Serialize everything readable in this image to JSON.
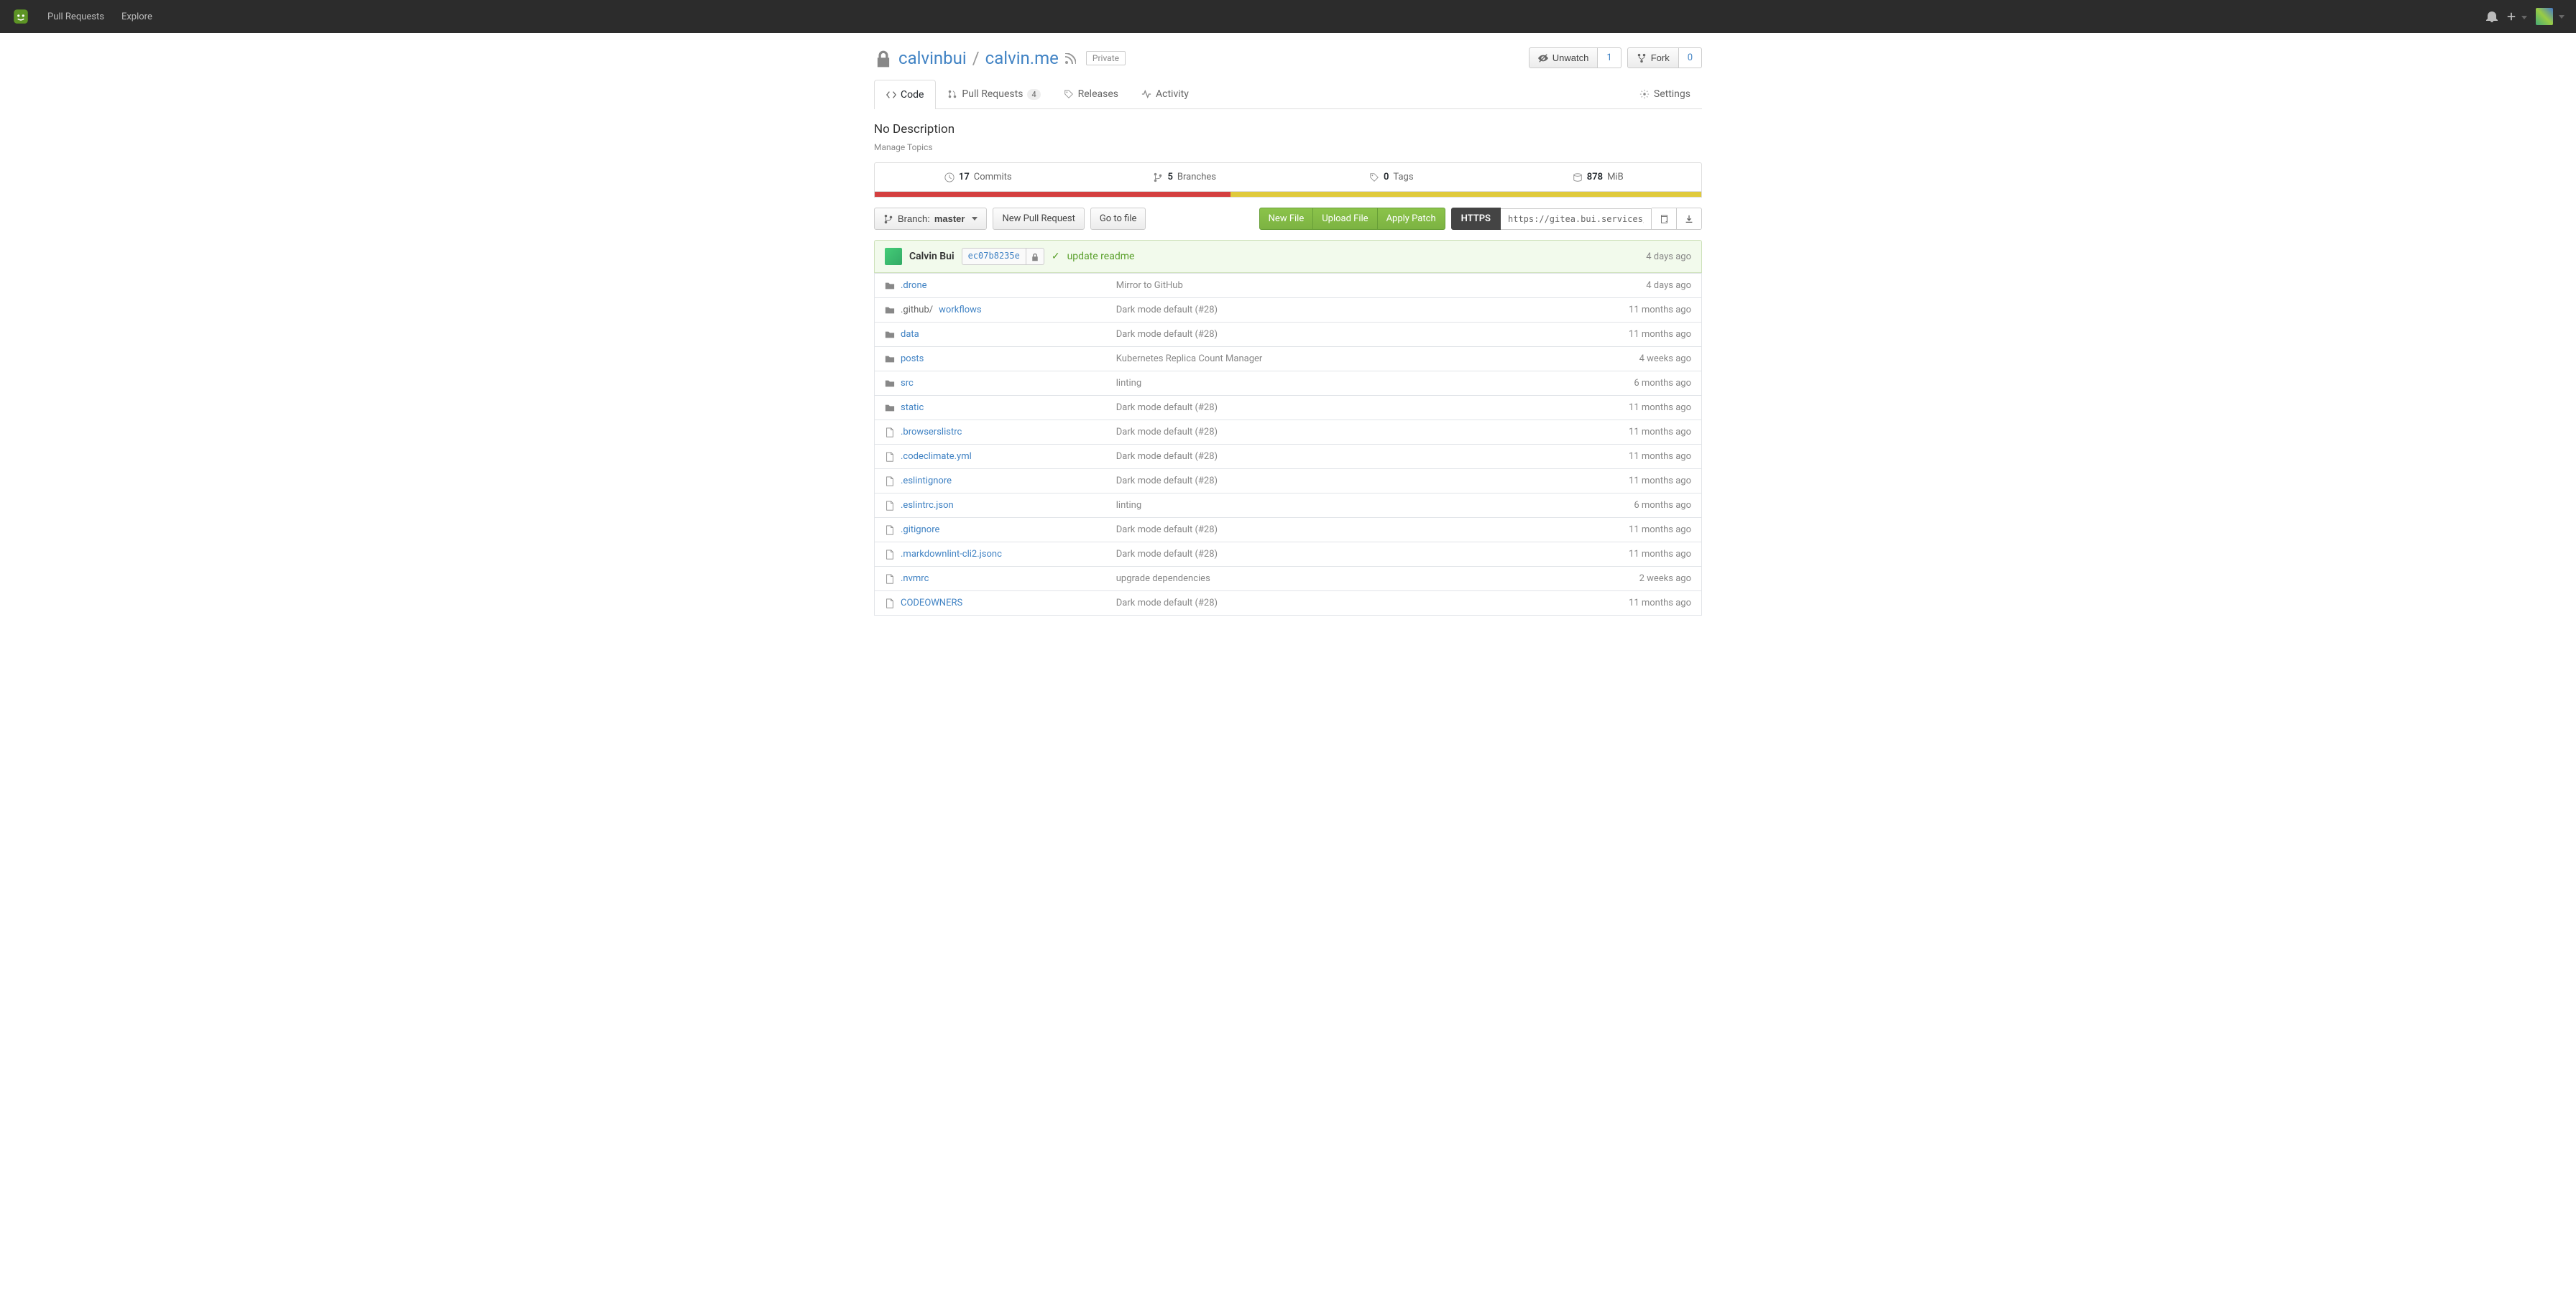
{
  "nav": {
    "pull_requests": "Pull Requests",
    "explore": "Explore"
  },
  "repo": {
    "owner": "calvinbui",
    "name": "calvin.me",
    "divider": "/",
    "visibility_badge": "Private",
    "unwatch_label": "Unwatch",
    "watch_count": "1",
    "fork_label": "Fork",
    "fork_count": "0"
  },
  "tabs": {
    "code": "Code",
    "pull_requests": "Pull Requests",
    "pull_requests_count": "4",
    "releases": "Releases",
    "activity": "Activity",
    "settings": "Settings"
  },
  "description": "No Description",
  "manage_topics": "Manage Topics",
  "stats": {
    "commits_count": "17",
    "commits_label": "Commits",
    "branches_count": "5",
    "branches_label": "Branches",
    "tags_count": "0",
    "tags_label": "Tags",
    "size_value": "878",
    "size_unit": "MiB"
  },
  "toolbar": {
    "branch_prefix": "Branch:",
    "branch_value": "master",
    "new_pr": "New Pull Request",
    "go_to_file": "Go to file",
    "new_file": "New File",
    "upload_file": "Upload File",
    "apply_patch": "Apply Patch",
    "https_label": "HTTPS",
    "clone_url": "https://gitea.bui.services/calvinbui/c"
  },
  "commit_bar": {
    "author": "Calvin Bui",
    "hash": "ec07b8235e",
    "message": "update readme",
    "time": "4 days ago"
  },
  "files": [
    {
      "icon": "dir",
      "name": ".drone",
      "name_plain": "",
      "msg": "Mirror to GitHub",
      "time": "4 days ago"
    },
    {
      "icon": "dir",
      "name": "workflows",
      "name_plain": ".github/",
      "msg": "Dark mode default (#28)",
      "time": "11 months ago"
    },
    {
      "icon": "dir",
      "name": "data",
      "name_plain": "",
      "msg": "Dark mode default (#28)",
      "time": "11 months ago"
    },
    {
      "icon": "dir",
      "name": "posts",
      "name_plain": "",
      "msg": "Kubernetes Replica Count Manager",
      "time": "4 weeks ago"
    },
    {
      "icon": "dir",
      "name": "src",
      "name_plain": "",
      "msg": "linting",
      "time": "6 months ago"
    },
    {
      "icon": "dir",
      "name": "static",
      "name_plain": "",
      "msg": "Dark mode default (#28)",
      "time": "11 months ago"
    },
    {
      "icon": "file",
      "name": ".browserslistrc",
      "name_plain": "",
      "msg": "Dark mode default (#28)",
      "time": "11 months ago"
    },
    {
      "icon": "file",
      "name": ".codeclimate.yml",
      "name_plain": "",
      "msg": "Dark mode default (#28)",
      "time": "11 months ago"
    },
    {
      "icon": "file",
      "name": ".eslintignore",
      "name_plain": "",
      "msg": "Dark mode default (#28)",
      "time": "11 months ago"
    },
    {
      "icon": "file",
      "name": ".eslintrc.json",
      "name_plain": "",
      "msg": "linting",
      "time": "6 months ago"
    },
    {
      "icon": "file",
      "name": ".gitignore",
      "name_plain": "",
      "msg": "Dark mode default (#28)",
      "time": "11 months ago"
    },
    {
      "icon": "file",
      "name": ".markdownlint-cli2.jsonc",
      "name_plain": "",
      "msg": "Dark mode default (#28)",
      "time": "11 months ago"
    },
    {
      "icon": "file",
      "name": ".nvmrc",
      "name_plain": "",
      "msg": "upgrade dependencies",
      "time": "2 weeks ago"
    },
    {
      "icon": "file",
      "name": "CODEOWNERS",
      "name_plain": "",
      "msg": "Dark mode default (#28)",
      "time": "11 months ago"
    }
  ]
}
